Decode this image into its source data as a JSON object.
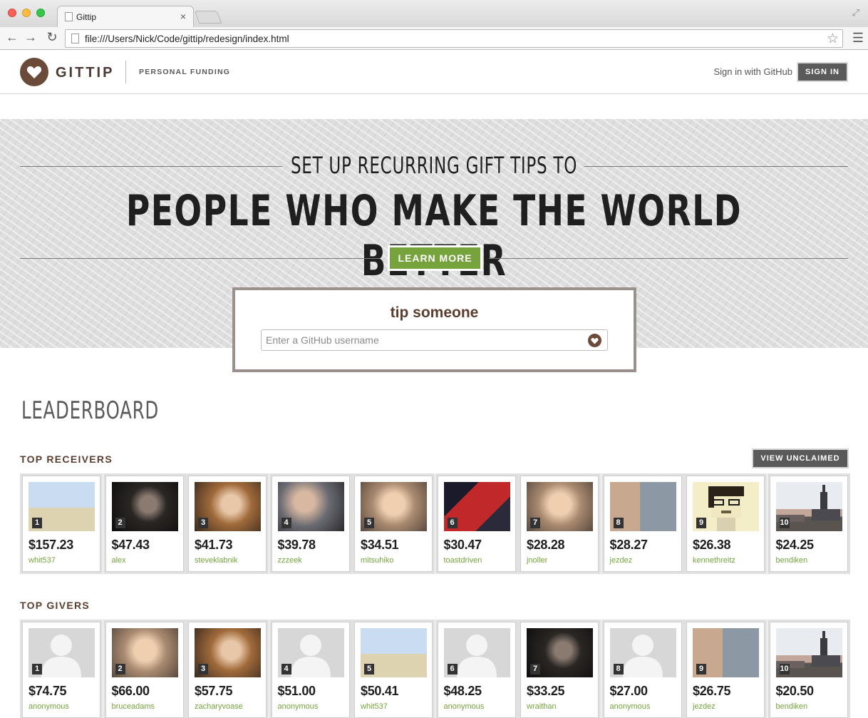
{
  "browser": {
    "tab_title": "Gittip",
    "tab_close": "×",
    "url": "file:///Users/Nick/Code/gittip/redesign/index.html"
  },
  "header": {
    "logo_text": "GITTIP",
    "tagline": "PERSONAL FUNDING",
    "signin_text": "Sign in with GitHub",
    "signin_button": "SIGN IN"
  },
  "hero": {
    "subtitle": "SET UP RECURRING GIFT TIPS TO",
    "title": "PEOPLE WHO MAKE THE WORLD BETTER",
    "learn_more": "LEARN MORE"
  },
  "tip": {
    "title": "tip someone",
    "placeholder": "Enter a GitHub username"
  },
  "leaderboard": {
    "title": "LEADERBOARD",
    "view_unclaimed": "VIEW UNCLAIMED",
    "receivers": {
      "title": "TOP RECEIVERS",
      "entries": [
        {
          "rank": "1",
          "amount": "$157.23",
          "username": "whit537",
          "avatar": "landscape"
        },
        {
          "rank": "2",
          "amount": "$47.43",
          "username": "alex",
          "avatar": "photo-dark"
        },
        {
          "rank": "3",
          "amount": "$41.73",
          "username": "steveklabnik",
          "avatar": "photo-warm"
        },
        {
          "rank": "4",
          "amount": "$39.78",
          "username": "zzzeek",
          "avatar": "photo-gray"
        },
        {
          "rank": "5",
          "amount": "$34.51",
          "username": "mitsuhiko",
          "avatar": "photo-face"
        },
        {
          "rank": "6",
          "amount": "$30.47",
          "username": "toastdriven",
          "avatar": "photo-red"
        },
        {
          "rank": "7",
          "amount": "$28.28",
          "username": "jnoller",
          "avatar": "photo-face"
        },
        {
          "rank": "8",
          "amount": "$28.27",
          "username": "jezdez",
          "avatar": "photo-city"
        },
        {
          "rank": "9",
          "amount": "$26.38",
          "username": "kennethreitz",
          "avatar": "pixel"
        },
        {
          "rank": "10",
          "amount": "$24.25",
          "username": "bendiken",
          "avatar": "photo-skyline"
        }
      ]
    },
    "givers": {
      "title": "TOP GIVERS",
      "entries": [
        {
          "rank": "1",
          "amount": "$74.75",
          "username": "anonymous",
          "avatar": "silhouette"
        },
        {
          "rank": "2",
          "amount": "$66.00",
          "username": "bruceadams",
          "avatar": "photo-face"
        },
        {
          "rank": "3",
          "amount": "$57.75",
          "username": "zacharyvoase",
          "avatar": "photo-warm"
        },
        {
          "rank": "4",
          "amount": "$51.00",
          "username": "anonymous",
          "avatar": "silhouette"
        },
        {
          "rank": "5",
          "amount": "$50.41",
          "username": "whit537",
          "avatar": "landscape"
        },
        {
          "rank": "6",
          "amount": "$48.25",
          "username": "anonymous",
          "avatar": "silhouette"
        },
        {
          "rank": "7",
          "amount": "$33.25",
          "username": "wraithan",
          "avatar": "photo-dark"
        },
        {
          "rank": "8",
          "amount": "$27.00",
          "username": "anonymous",
          "avatar": "silhouette"
        },
        {
          "rank": "9",
          "amount": "$26.75",
          "username": "jezdez",
          "avatar": "photo-city"
        },
        {
          "rank": "10",
          "amount": "$20.50",
          "username": "bendiken",
          "avatar": "photo-skyline"
        }
      ]
    }
  },
  "colors": {
    "brand_brown": "#6b4a3a",
    "accent_green": "#76a33c",
    "button_gray": "#5a5a5a"
  }
}
